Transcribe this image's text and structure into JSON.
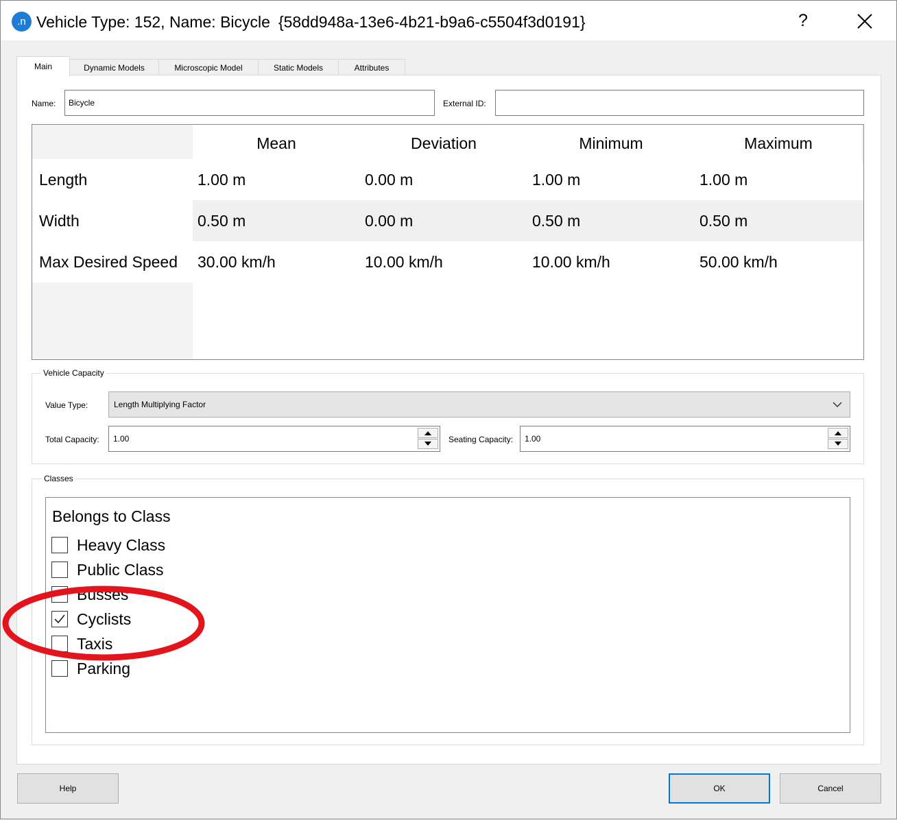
{
  "window": {
    "icon_text": ".n",
    "title": "Vehicle Type: 152, Name: Bicycle",
    "guid": "{58dd948a-13e6-4b21-b9a6-c5504f3d0191}",
    "help": "?"
  },
  "tabs": [
    "Main",
    "Dynamic Models",
    "Microscopic Model",
    "Static Models",
    "Attributes"
  ],
  "main": {
    "name_label": "Name:",
    "name_value": "Bicycle",
    "external_id_label": "External ID:",
    "external_id_value": ""
  },
  "grid": {
    "columns": [
      "Mean",
      "Deviation",
      "Minimum",
      "Maximum"
    ],
    "rows": [
      {
        "label": "Length",
        "values": [
          "1.00 m",
          "0.00 m",
          "1.00 m",
          "1.00 m"
        ]
      },
      {
        "label": "Width",
        "values": [
          "0.50 m",
          "0.00 m",
          "0.50 m",
          "0.50 m"
        ]
      },
      {
        "label": "Max Desired Speed",
        "values": [
          "30.00 km/h",
          "10.00 km/h",
          "10.00 km/h",
          "50.00 km/h"
        ]
      }
    ]
  },
  "capacity": {
    "group_title": "Vehicle Capacity",
    "value_type_label": "Value Type:",
    "value_type": "Length Multiplying Factor",
    "total_label": "Total Capacity:",
    "total_value": "1.00",
    "seating_label": "Seating Capacity:",
    "seating_value": "1.00"
  },
  "classes": {
    "group_title": "Classes",
    "header": "Belongs to Class",
    "items": [
      {
        "label": "Heavy Class",
        "checked": false
      },
      {
        "label": "Public Class",
        "checked": false
      },
      {
        "label": "Busses",
        "checked": false
      },
      {
        "label": "Cyclists",
        "checked": true
      },
      {
        "label": "Taxis",
        "checked": false
      },
      {
        "label": "Parking",
        "checked": false
      }
    ]
  },
  "buttons": {
    "help": "Help",
    "ok": "OK",
    "cancel": "Cancel"
  },
  "colors": {
    "accent": "#0078d7",
    "annotation": "#e3141b",
    "app_icon": "#1e7bd6"
  }
}
